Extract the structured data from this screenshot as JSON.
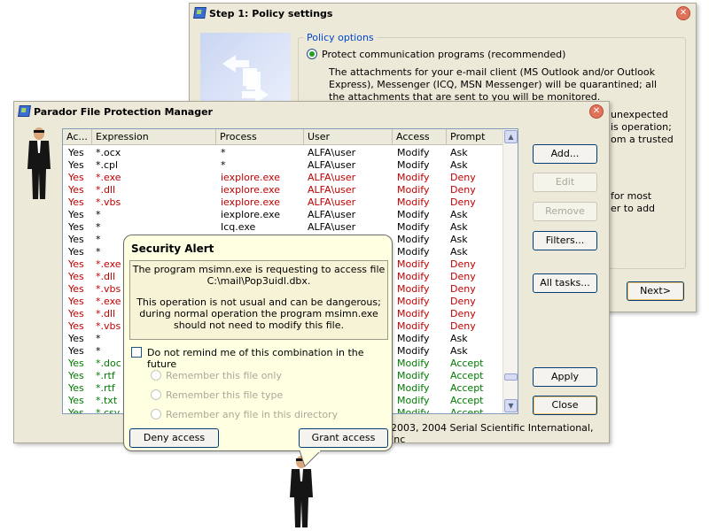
{
  "step_window": {
    "title": "Step 1: Policy settings",
    "group_title": "Policy options",
    "radio_label": "Protect communication programs (recommended)",
    "description": "The attachments for your e-mail client (MS Outlook and/or Outlook Express), Messenger (ICQ, MSN Messenger) will be quarantined; all the attachments that are sent to you will be monitored.",
    "partial_lines": [
      "unexpected",
      "is operation;",
      "om a trusted",
      "for most",
      "er to add"
    ],
    "next_label": "Next>"
  },
  "manager": {
    "title": "Parador File Protection Manager",
    "columns": [
      "Ac...",
      "Expression",
      "Process",
      "User",
      "Access",
      "Prompt"
    ],
    "rows": [
      {
        "access": "Yes",
        "expr": "*.ocx",
        "proc": "*",
        "user": "ALFA\\user",
        "mode": "Modify",
        "prompt": "Ask",
        "color": "black"
      },
      {
        "access": "Yes",
        "expr": "*.cpl",
        "proc": "*",
        "user": "ALFA\\user",
        "mode": "Modify",
        "prompt": "Ask",
        "color": "black"
      },
      {
        "access": "Yes",
        "expr": "*.exe",
        "proc": "iexplore.exe",
        "user": "ALFA\\user",
        "mode": "Modify",
        "prompt": "Deny",
        "color": "red"
      },
      {
        "access": "Yes",
        "expr": "*.dll",
        "proc": "iexplore.exe",
        "user": "ALFA\\user",
        "mode": "Modify",
        "prompt": "Deny",
        "color": "red"
      },
      {
        "access": "Yes",
        "expr": "*.vbs",
        "proc": "iexplore.exe",
        "user": "ALFA\\user",
        "mode": "Modify",
        "prompt": "Deny",
        "color": "red"
      },
      {
        "access": "Yes",
        "expr": "*",
        "proc": "iexplore.exe",
        "user": "ALFA\\user",
        "mode": "Modify",
        "prompt": "Ask",
        "color": "black"
      },
      {
        "access": "Yes",
        "expr": "*",
        "proc": "Icq.exe",
        "user": "ALFA\\user",
        "mode": "Modify",
        "prompt": "Ask",
        "color": "black"
      },
      {
        "access": "Yes",
        "expr": "*",
        "proc": "",
        "user": "",
        "mode": "Modify",
        "prompt": "Ask",
        "color": "black"
      },
      {
        "access": "Yes",
        "expr": "*",
        "proc": "",
        "user": "",
        "mode": "Modify",
        "prompt": "Ask",
        "color": "black"
      },
      {
        "access": "Yes",
        "expr": "*.exe",
        "proc": "",
        "user": "",
        "mode": "Modify",
        "prompt": "Deny",
        "color": "red"
      },
      {
        "access": "Yes",
        "expr": "*.dll",
        "proc": "",
        "user": "",
        "mode": "Modify",
        "prompt": "Deny",
        "color": "red"
      },
      {
        "access": "Yes",
        "expr": "*.vbs",
        "proc": "",
        "user": "",
        "mode": "Modify",
        "prompt": "Deny",
        "color": "red"
      },
      {
        "access": "Yes",
        "expr": "*.exe",
        "proc": "",
        "user": "",
        "mode": "Modify",
        "prompt": "Deny",
        "color": "red"
      },
      {
        "access": "Yes",
        "expr": "*.dll",
        "proc": "",
        "user": "",
        "mode": "Modify",
        "prompt": "Deny",
        "color": "red"
      },
      {
        "access": "Yes",
        "expr": "*.vbs",
        "proc": "",
        "user": "",
        "mode": "Modify",
        "prompt": "Deny",
        "color": "red"
      },
      {
        "access": "Yes",
        "expr": "*",
        "proc": "",
        "user": "",
        "mode": "Modify",
        "prompt": "Ask",
        "color": "black"
      },
      {
        "access": "Yes",
        "expr": "*",
        "proc": "",
        "user": "",
        "mode": "Modify",
        "prompt": "Ask",
        "color": "black"
      },
      {
        "access": "Yes",
        "expr": "*.doc",
        "proc": "",
        "user": "",
        "mode": "Modify",
        "prompt": "Accept",
        "color": "green"
      },
      {
        "access": "Yes",
        "expr": "*.rtf",
        "proc": "",
        "user": "",
        "mode": "Modify",
        "prompt": "Accept",
        "color": "green"
      },
      {
        "access": "Yes",
        "expr": "*.rtf",
        "proc": "",
        "user": "",
        "mode": "Modify",
        "prompt": "Accept",
        "color": "green"
      },
      {
        "access": "Yes",
        "expr": "*.txt",
        "proc": "",
        "user": "",
        "mode": "Modify",
        "prompt": "Accept",
        "color": "green"
      },
      {
        "access": "Yes",
        "expr": "*.csv",
        "proc": "",
        "user": "",
        "mode": "Modify",
        "prompt": "Accept",
        "color": "green"
      }
    ],
    "buttons": {
      "add": "Add...",
      "edit": "Edit",
      "remove": "Remove",
      "filters": "Filters...",
      "all_tasks": "All tasks...",
      "apply": "Apply",
      "close": "Close"
    },
    "copyright": "2003, 2004 Serial Scientific International, Inc"
  },
  "alert": {
    "title": "Security Alert",
    "message_line1": "The program msimn.exe is requesting to access file",
    "message_line2": "C:\\mail\\Pop3uidl.dbx.",
    "message_line3": "This operation is not usual and can be dangerous; during normal operation the program msimn.exe should not need to modify this file.",
    "checkbox_label": "Do not remind me of this combination in the future",
    "options": [
      "Remember this file only",
      "Remember this file type",
      "Remember any file in this directory"
    ],
    "deny_label": "Deny access",
    "grant_label": "Grant access"
  },
  "colors": {
    "deny": "#c00000",
    "accept": "#007a00",
    "balloon": "#ffffe1",
    "window": "#ece9d8"
  },
  "icons": [
    "app-icon",
    "close-icon",
    "agent-figure",
    "wizard-graphic",
    "scroll-up-icon",
    "scroll-down-icon"
  ]
}
